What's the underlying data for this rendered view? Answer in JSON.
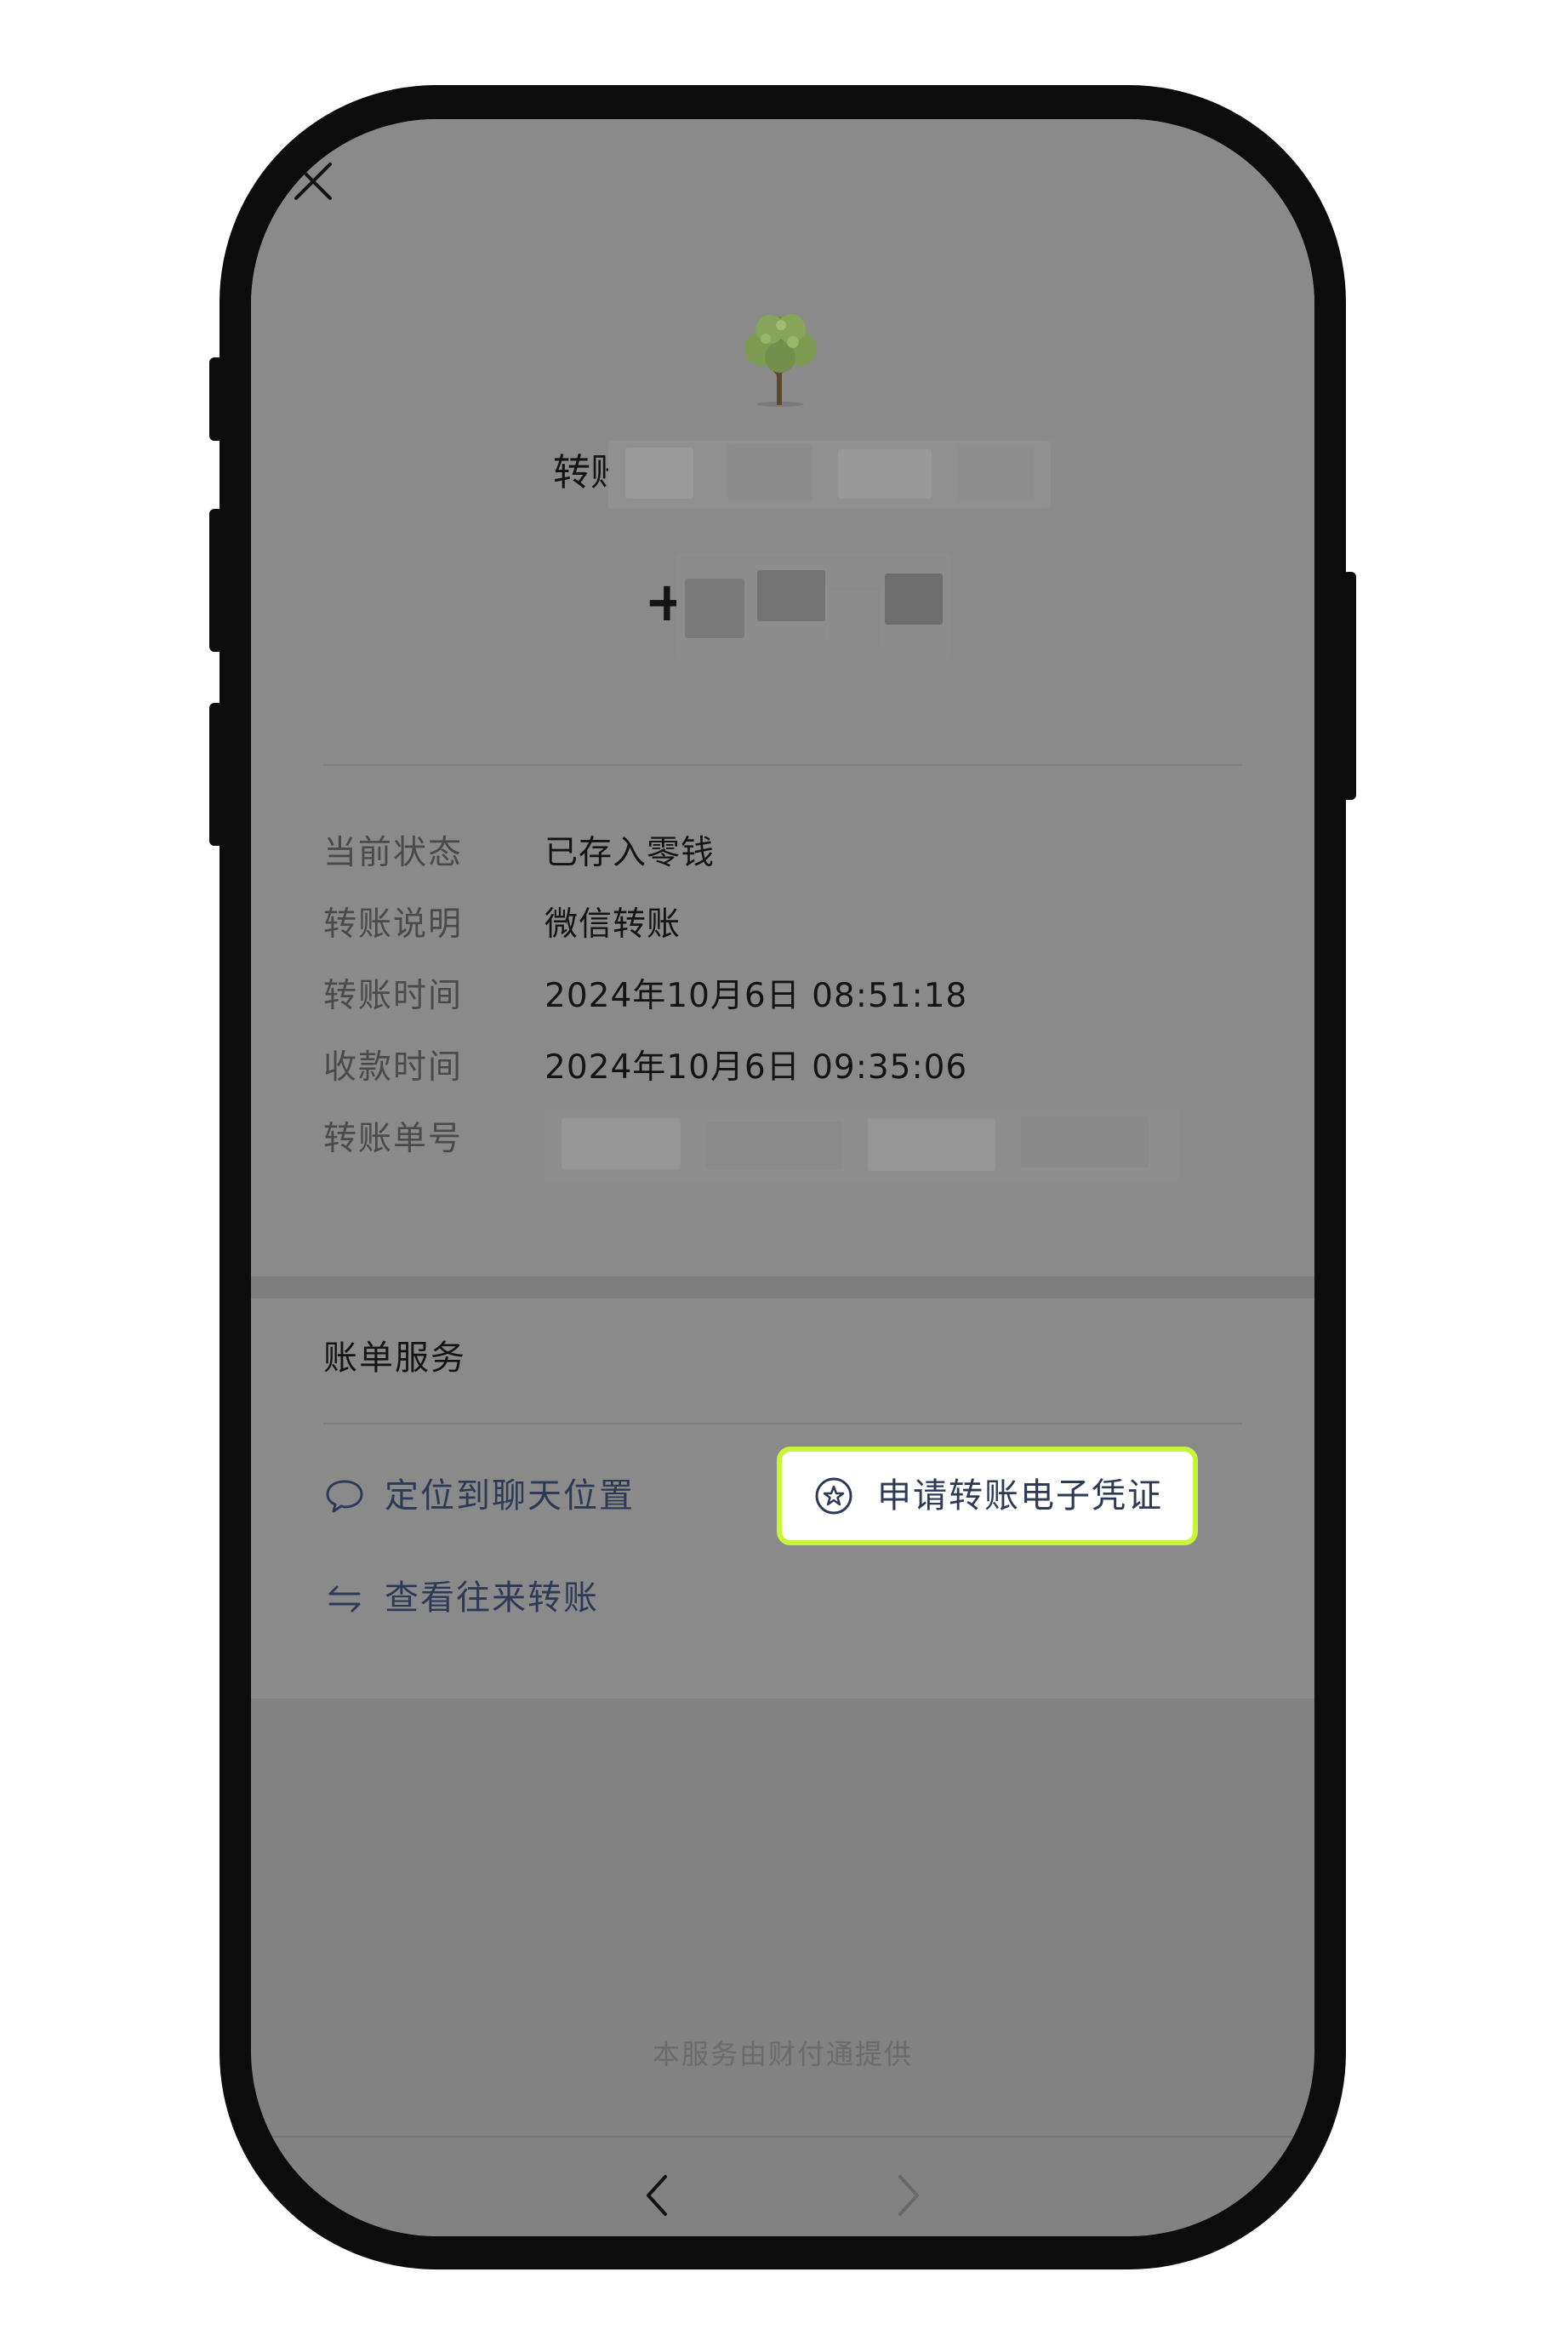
{
  "header": {
    "close_icon": "close-icon",
    "avatar_icon": "tree-avatar-icon",
    "title_prefix": "转账",
    "amount_sign": "+"
  },
  "details": [
    {
      "label": "当前状态",
      "value": "已存入零钱"
    },
    {
      "label": "转账说明",
      "value": "微信转账"
    },
    {
      "label": "转账时间",
      "value": "2024年10月6日 08:51:18"
    },
    {
      "label": "收款时间",
      "value": "2024年10月6日 09:35:06"
    },
    {
      "label": "转账单号",
      "value": ""
    }
  ],
  "services": {
    "title": "账单服务",
    "locate_chat": {
      "label": "定位到聊天位置",
      "icon": "chat-bubble-icon"
    },
    "apply_voucher": {
      "label": "申请转账电子凭证",
      "icon": "star-circle-icon"
    },
    "view_history": {
      "label": "查看往来转账",
      "icon": "swap-arrows-icon"
    }
  },
  "footer": {
    "provider_note": "本服务由财付通提供"
  },
  "nav": {
    "back_icon": "chevron-left-icon",
    "forward_icon": "chevron-right-icon"
  },
  "colors": {
    "overlay_gray": "#8a8a8a",
    "highlight_border": "#c7f53a",
    "link_text": "#2e3a55"
  }
}
